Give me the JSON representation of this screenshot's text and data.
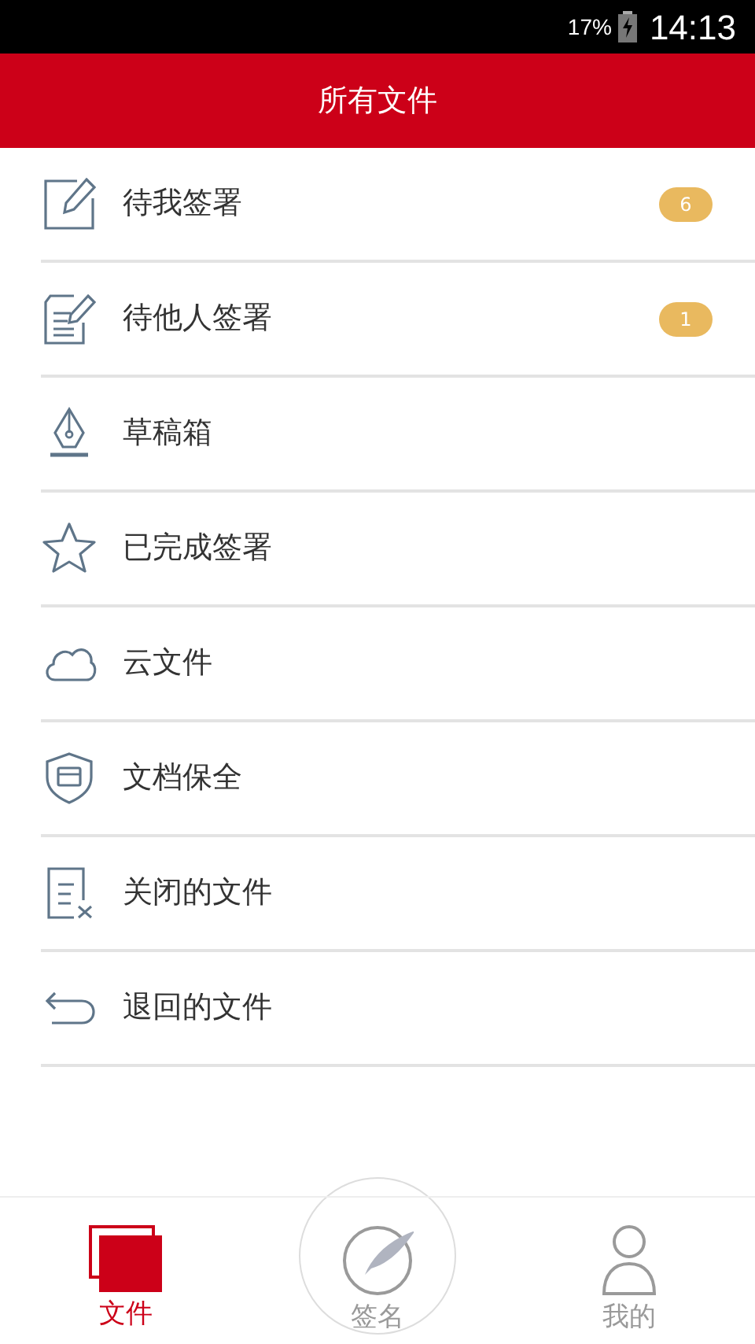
{
  "status_bar": {
    "battery": "17%",
    "time": "14:13"
  },
  "header": {
    "title": "所有文件"
  },
  "items": [
    {
      "kind": "edit",
      "label": "待我签署",
      "badge": "6"
    },
    {
      "kind": "doc-edit",
      "label": "待他人签署",
      "badge": "1"
    },
    {
      "kind": "pen",
      "label": "草稿箱"
    },
    {
      "kind": "star",
      "label": "已完成签署"
    },
    {
      "kind": "cloud",
      "label": "云文件"
    },
    {
      "kind": "shield",
      "label": "文档保全"
    },
    {
      "kind": "doc-x",
      "label": "关闭的文件"
    },
    {
      "kind": "return",
      "label": "退回的文件"
    }
  ],
  "tabs": [
    {
      "kind": "files",
      "label": "文件",
      "selected": true
    },
    {
      "kind": "sign",
      "label": "签名",
      "selected": false
    },
    {
      "kind": "user",
      "label": "我的",
      "selected": false
    }
  ]
}
